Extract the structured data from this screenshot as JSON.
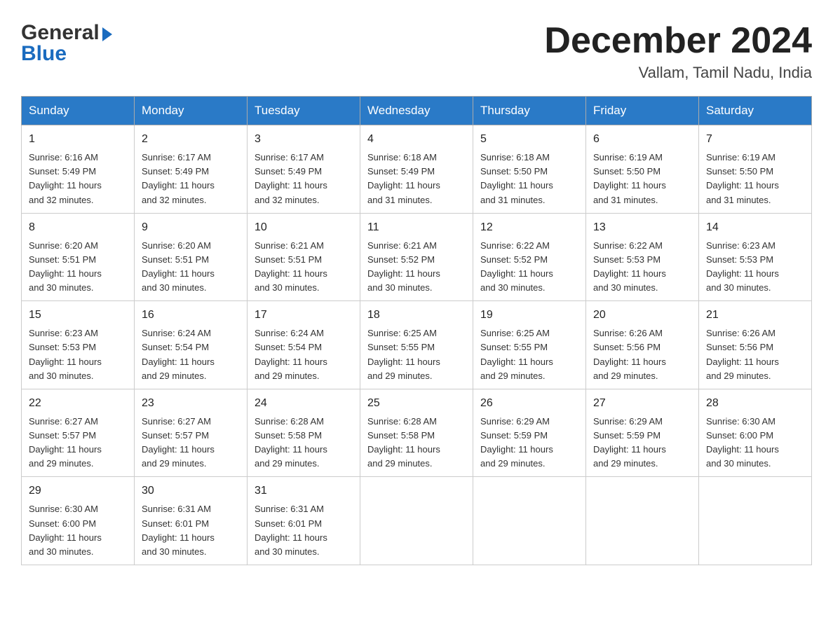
{
  "header": {
    "logo_line1": "General",
    "logo_arrow": "▶",
    "logo_line2": "Blue",
    "month_year": "December 2024",
    "location": "Vallam, Tamil Nadu, India"
  },
  "weekdays": [
    "Sunday",
    "Monday",
    "Tuesday",
    "Wednesday",
    "Thursday",
    "Friday",
    "Saturday"
  ],
  "weeks": [
    [
      {
        "day": "1",
        "info": "Sunrise: 6:16 AM\nSunset: 5:49 PM\nDaylight: 11 hours\nand 32 minutes."
      },
      {
        "day": "2",
        "info": "Sunrise: 6:17 AM\nSunset: 5:49 PM\nDaylight: 11 hours\nand 32 minutes."
      },
      {
        "day": "3",
        "info": "Sunrise: 6:17 AM\nSunset: 5:49 PM\nDaylight: 11 hours\nand 32 minutes."
      },
      {
        "day": "4",
        "info": "Sunrise: 6:18 AM\nSunset: 5:49 PM\nDaylight: 11 hours\nand 31 minutes."
      },
      {
        "day": "5",
        "info": "Sunrise: 6:18 AM\nSunset: 5:50 PM\nDaylight: 11 hours\nand 31 minutes."
      },
      {
        "day": "6",
        "info": "Sunrise: 6:19 AM\nSunset: 5:50 PM\nDaylight: 11 hours\nand 31 minutes."
      },
      {
        "day": "7",
        "info": "Sunrise: 6:19 AM\nSunset: 5:50 PM\nDaylight: 11 hours\nand 31 minutes."
      }
    ],
    [
      {
        "day": "8",
        "info": "Sunrise: 6:20 AM\nSunset: 5:51 PM\nDaylight: 11 hours\nand 30 minutes."
      },
      {
        "day": "9",
        "info": "Sunrise: 6:20 AM\nSunset: 5:51 PM\nDaylight: 11 hours\nand 30 minutes."
      },
      {
        "day": "10",
        "info": "Sunrise: 6:21 AM\nSunset: 5:51 PM\nDaylight: 11 hours\nand 30 minutes."
      },
      {
        "day": "11",
        "info": "Sunrise: 6:21 AM\nSunset: 5:52 PM\nDaylight: 11 hours\nand 30 minutes."
      },
      {
        "day": "12",
        "info": "Sunrise: 6:22 AM\nSunset: 5:52 PM\nDaylight: 11 hours\nand 30 minutes."
      },
      {
        "day": "13",
        "info": "Sunrise: 6:22 AM\nSunset: 5:53 PM\nDaylight: 11 hours\nand 30 minutes."
      },
      {
        "day": "14",
        "info": "Sunrise: 6:23 AM\nSunset: 5:53 PM\nDaylight: 11 hours\nand 30 minutes."
      }
    ],
    [
      {
        "day": "15",
        "info": "Sunrise: 6:23 AM\nSunset: 5:53 PM\nDaylight: 11 hours\nand 30 minutes."
      },
      {
        "day": "16",
        "info": "Sunrise: 6:24 AM\nSunset: 5:54 PM\nDaylight: 11 hours\nand 29 minutes."
      },
      {
        "day": "17",
        "info": "Sunrise: 6:24 AM\nSunset: 5:54 PM\nDaylight: 11 hours\nand 29 minutes."
      },
      {
        "day": "18",
        "info": "Sunrise: 6:25 AM\nSunset: 5:55 PM\nDaylight: 11 hours\nand 29 minutes."
      },
      {
        "day": "19",
        "info": "Sunrise: 6:25 AM\nSunset: 5:55 PM\nDaylight: 11 hours\nand 29 minutes."
      },
      {
        "day": "20",
        "info": "Sunrise: 6:26 AM\nSunset: 5:56 PM\nDaylight: 11 hours\nand 29 minutes."
      },
      {
        "day": "21",
        "info": "Sunrise: 6:26 AM\nSunset: 5:56 PM\nDaylight: 11 hours\nand 29 minutes."
      }
    ],
    [
      {
        "day": "22",
        "info": "Sunrise: 6:27 AM\nSunset: 5:57 PM\nDaylight: 11 hours\nand 29 minutes."
      },
      {
        "day": "23",
        "info": "Sunrise: 6:27 AM\nSunset: 5:57 PM\nDaylight: 11 hours\nand 29 minutes."
      },
      {
        "day": "24",
        "info": "Sunrise: 6:28 AM\nSunset: 5:58 PM\nDaylight: 11 hours\nand 29 minutes."
      },
      {
        "day": "25",
        "info": "Sunrise: 6:28 AM\nSunset: 5:58 PM\nDaylight: 11 hours\nand 29 minutes."
      },
      {
        "day": "26",
        "info": "Sunrise: 6:29 AM\nSunset: 5:59 PM\nDaylight: 11 hours\nand 29 minutes."
      },
      {
        "day": "27",
        "info": "Sunrise: 6:29 AM\nSunset: 5:59 PM\nDaylight: 11 hours\nand 29 minutes."
      },
      {
        "day": "28",
        "info": "Sunrise: 6:30 AM\nSunset: 6:00 PM\nDaylight: 11 hours\nand 30 minutes."
      }
    ],
    [
      {
        "day": "29",
        "info": "Sunrise: 6:30 AM\nSunset: 6:00 PM\nDaylight: 11 hours\nand 30 minutes."
      },
      {
        "day": "30",
        "info": "Sunrise: 6:31 AM\nSunset: 6:01 PM\nDaylight: 11 hours\nand 30 minutes."
      },
      {
        "day": "31",
        "info": "Sunrise: 6:31 AM\nSunset: 6:01 PM\nDaylight: 11 hours\nand 30 minutes."
      },
      null,
      null,
      null,
      null
    ]
  ]
}
